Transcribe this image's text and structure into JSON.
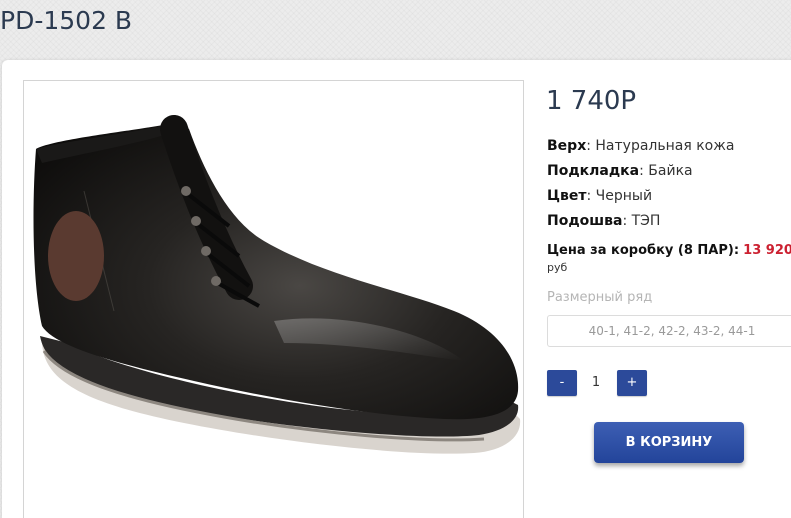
{
  "product": {
    "title": "PD-1502 B",
    "price": "1 740Р",
    "specs": [
      {
        "label": "Верх",
        "value": "Натуральная кожа"
      },
      {
        "label": "Подкладка",
        "value": "Байка"
      },
      {
        "label": "Цвет",
        "value": "Черный"
      },
      {
        "label": "Подошва",
        "value": "ТЭП"
      }
    ],
    "box_price_label": "Цена за коробку (8 ПАР):",
    "box_price_value": "13 920",
    "box_price_currency": "руб",
    "size_label": "Размерный ряд",
    "size_value": "40-1, 41-2, 42-2, 43-2, 44-1"
  },
  "quantity": {
    "minus_label": "-",
    "value": "1",
    "plus_label": "+"
  },
  "cart": {
    "button_label": "В КОРЗИНУ"
  },
  "colors": {
    "accent": "#2c4a9a",
    "box_price": "#cc2131",
    "title": "#2b3a50"
  }
}
